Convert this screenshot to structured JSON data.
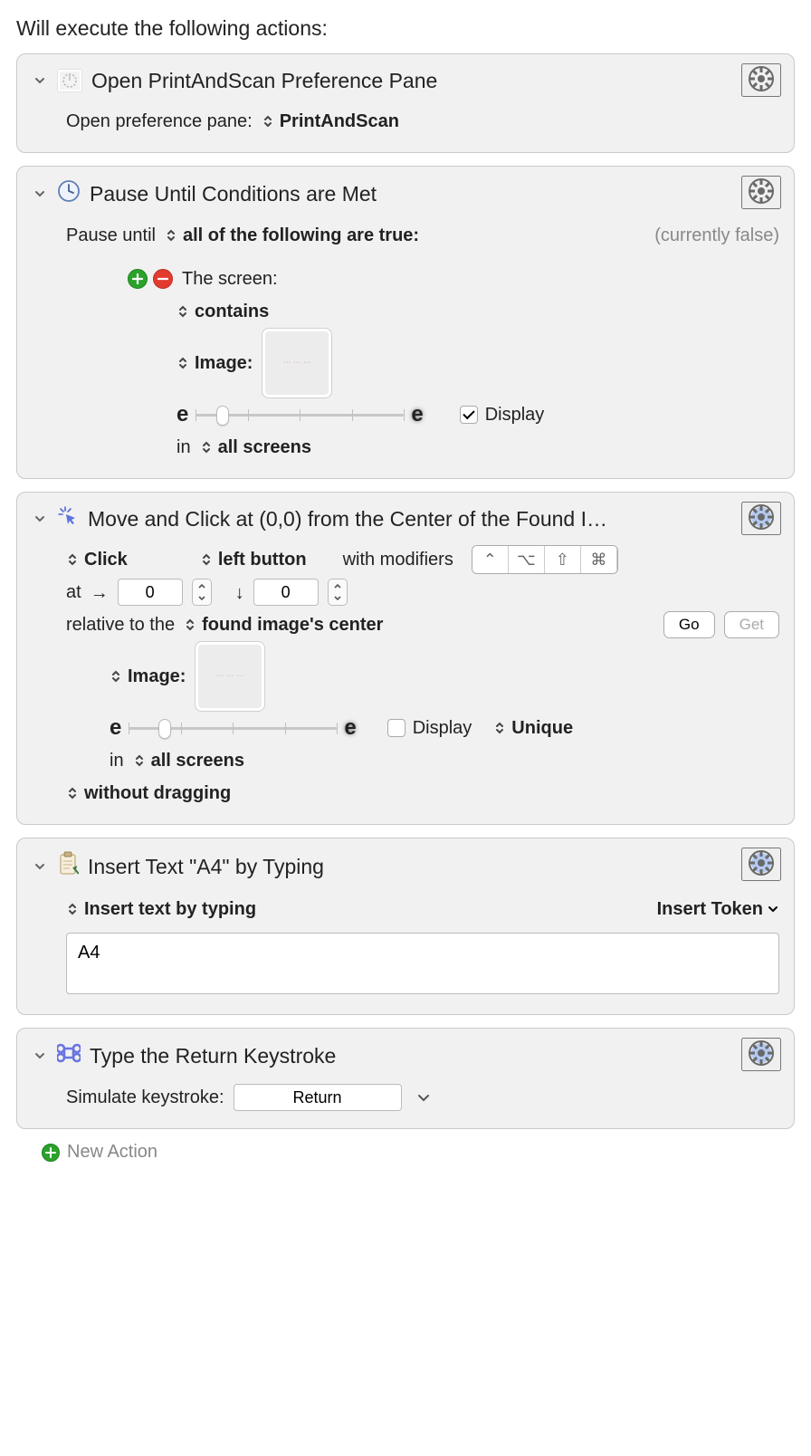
{
  "header": {
    "title": "Will execute the following actions:"
  },
  "action1": {
    "title": "Open PrintAndScan Preference Pane",
    "label": "Open preference pane:",
    "value": "PrintAndScan"
  },
  "action2": {
    "title": "Pause Until Conditions are Met",
    "pause_label": "Pause until",
    "pause_mode": "all of the following are true:",
    "status": "(currently false)",
    "cond_label": "The screen:",
    "contains": "contains",
    "image_label": "Image:",
    "display_label": "Display",
    "in_label": "in",
    "in_value": "all screens",
    "slider_left": "e",
    "slider_right": "e"
  },
  "action3": {
    "title": "Move and Click at (0,0) from the Center of the Found I…",
    "click": "Click",
    "button": "left button",
    "with_mod": "with modifiers",
    "at": "at",
    "x": "0",
    "y": "0",
    "rel_label": "relative to the",
    "rel_value": "found image's center",
    "go": "Go",
    "get": "Get",
    "image_label": "Image:",
    "display_label": "Display",
    "unique_label": "Unique",
    "in_label": "in",
    "in_value": "all screens",
    "drag": "without dragging",
    "slider_left": "e",
    "slider_right": "e",
    "modifiers": {
      "ctrl": "⌃",
      "opt": "⌥",
      "shift": "⇧",
      "cmd": "⌘"
    }
  },
  "action4": {
    "title": "Insert Text \"A4\" by Typing",
    "mode": "Insert text by typing",
    "token_btn": "Insert Token",
    "text": "A4"
  },
  "action5": {
    "title": "Type the Return Keystroke",
    "label": "Simulate keystroke:",
    "key": "Return"
  },
  "footer": {
    "new_action": "New Action"
  }
}
